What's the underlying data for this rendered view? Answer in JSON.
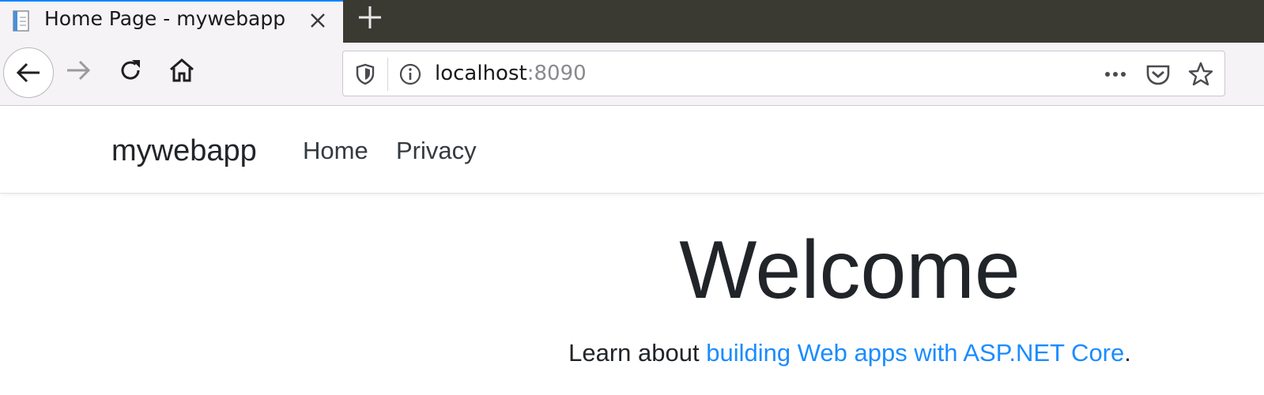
{
  "browser": {
    "tab": {
      "title": "Home Page - mywebapp"
    },
    "address": {
      "host": "localhost",
      "port": ":8090"
    }
  },
  "site": {
    "brand": "mywebapp",
    "nav": {
      "home": "Home",
      "privacy": "Privacy"
    },
    "heading": "Welcome",
    "learn": {
      "prefix": "Learn about ",
      "link": "building Web apps with ASP.NET Core",
      "suffix": "."
    }
  },
  "colors": {
    "tab_strip": "#3b3a32",
    "toolbar": "#f5f3f6",
    "link": "#1a8cff",
    "text": "#212529"
  },
  "icons": [
    "page-icon",
    "close-icon",
    "plus-icon",
    "back-arrow-icon",
    "forward-arrow-icon",
    "reload-icon",
    "home-icon",
    "shield-icon",
    "info-icon",
    "more-icon",
    "pocket-icon",
    "star-icon"
  ]
}
